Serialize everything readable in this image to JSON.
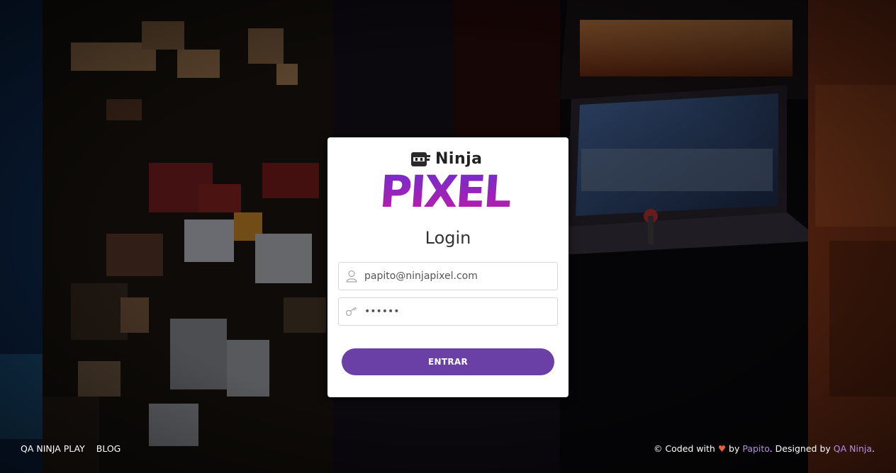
{
  "brand": {
    "logo_top": "Ninja",
    "logo_bottom": "PIXEL"
  },
  "login": {
    "title": "Login",
    "email_value": "papito@ninjapixel.com",
    "email_icon": "user-icon",
    "password_value": "••••••",
    "password_icon": "key-icon",
    "submit_label": "ENTRAR"
  },
  "footer": {
    "links": [
      "QA NINJA PLAY",
      "BLOG"
    ],
    "credit_prefix": "© Coded with",
    "credit_by": "by",
    "author": "Papito",
    "designed_by": ". Designed by",
    "designer": "QA Ninja",
    "suffix": "."
  },
  "colors": {
    "accent": "#6a3fa6",
    "link": "#b88ae8",
    "heart": "#e8603a"
  }
}
